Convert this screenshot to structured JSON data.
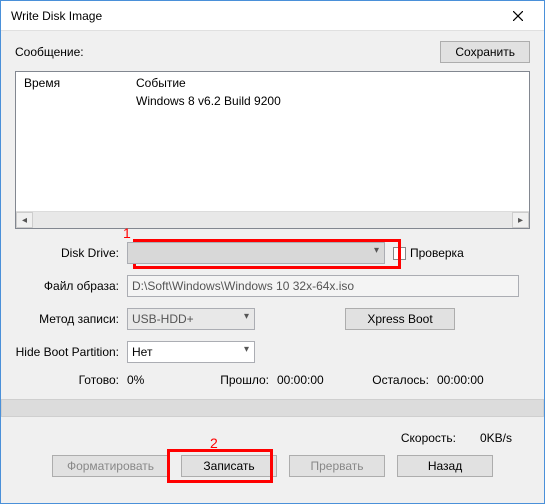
{
  "window": {
    "title": "Write Disk Image"
  },
  "messages": {
    "label": "Сообщение:",
    "save_btn": "Сохранить",
    "col_time": "Время",
    "col_event": "Событие",
    "events": [
      "Windows 8 v6.2 Build 9200"
    ]
  },
  "form": {
    "disk_drive_label": "Disk Drive:",
    "disk_drive_value": "",
    "check_label": "Проверка",
    "image_file_label": "Файл образа:",
    "image_file_value": "D:\\Soft\\Windows\\Windows 10 32x-64x.iso",
    "method_label": "Метод записи:",
    "method_value": "USB-HDD+",
    "xpress_btn": "Xpress Boot",
    "hide_label": "Hide Boot Partition:",
    "hide_value": "Нет"
  },
  "status": {
    "ready_label": "Готово:",
    "ready_value": "0%",
    "elapsed_label": "Прошло:",
    "elapsed_value": "00:00:00",
    "remaining_label": "Осталось:",
    "remaining_value": "00:00:00",
    "speed_label": "Скорость:",
    "speed_value": "0KB/s"
  },
  "buttons": {
    "format": "Форматировать",
    "write": "Записать",
    "abort": "Прервать",
    "back": "Назад"
  },
  "annotations": {
    "one": "1",
    "two": "2"
  }
}
